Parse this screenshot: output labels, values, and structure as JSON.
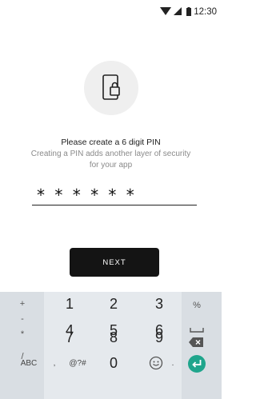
{
  "status_bar": {
    "time": "12:30",
    "icons": [
      "wifi-icon",
      "signal-icon",
      "battery-icon"
    ]
  },
  "content": {
    "icon": "phone-lock-icon",
    "title": "Please create a 6 digit PIN",
    "subtitle": "Creating a PIN adds another layer of security for your app",
    "pin_value": "* * * * * *",
    "next_label": "NEXT"
  },
  "keyboard": {
    "symbols": {
      "plus": "+",
      "minus": "-",
      "asterisk": "*",
      "slash": "/",
      "abc": "ABC",
      "comma": ",",
      "symbols": "@?#",
      "percent": "%",
      "period": "."
    },
    "digits": [
      "1",
      "2",
      "3",
      "4",
      "5",
      "6",
      "7",
      "8",
      "9",
      "0"
    ],
    "icons": [
      "space-icon",
      "backspace-icon",
      "emoji-icon",
      "enter-icon"
    ]
  },
  "colors": {
    "accent": "#1fa58c",
    "button": "#141414",
    "keyboard_bg": "#e5e9ed"
  }
}
